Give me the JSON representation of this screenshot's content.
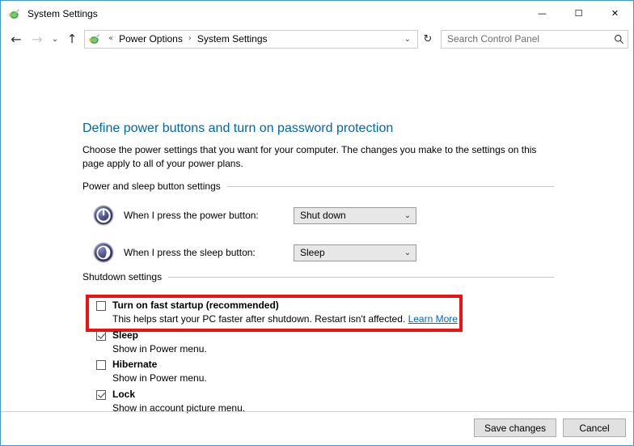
{
  "window": {
    "title": "System Settings",
    "icon": "power-plug-icon",
    "border_color": "#3a96dd",
    "controls": {
      "minimize": "—",
      "maximize": "☐",
      "close": "✕"
    }
  },
  "nav": {
    "back": "←",
    "forward": "→",
    "recent": "⌄",
    "up": "↑",
    "refresh": "↻",
    "breadcrumb": {
      "prefix": "«",
      "items": [
        "Power Options",
        "System Settings"
      ],
      "separator": "›",
      "dropdown": "⌄"
    }
  },
  "search": {
    "placeholder": "Search Control Panel",
    "icon": "search-icon"
  },
  "page": {
    "title": "Define power buttons and turn on password protection",
    "description": "Choose the power settings that you want for your computer. The changes you make to the settings on this page apply to all of your power plans."
  },
  "sections": {
    "power_sleep": {
      "header": "Power and sleep button settings",
      "rows": [
        {
          "icon": "power-button-icon",
          "label": "When I press the power button:",
          "value": "Shut down",
          "arrow": "⌄"
        },
        {
          "icon": "sleep-button-icon",
          "label": "When I press the sleep button:",
          "value": "Sleep",
          "arrow": "⌄"
        }
      ]
    },
    "shutdown": {
      "header": "Shutdown settings",
      "highlight_color": "#ee1111",
      "items": [
        {
          "title": "Turn on fast startup (recommended)",
          "checked": false,
          "subtitle": "This helps start your PC faster after shutdown. Restart isn't affected.",
          "link": "Learn More",
          "highlighted": true
        },
        {
          "title": "Sleep",
          "checked": true,
          "subtitle": "Show in Power menu.",
          "link": "",
          "highlighted": false
        },
        {
          "title": "Hibernate",
          "checked": false,
          "subtitle": "Show in Power menu.",
          "link": "",
          "highlighted": false
        },
        {
          "title": "Lock",
          "checked": true,
          "subtitle": "Show in account picture menu.",
          "link": "",
          "highlighted": false
        }
      ]
    }
  },
  "footer": {
    "save_label": "Save changes",
    "cancel_label": "Cancel"
  }
}
